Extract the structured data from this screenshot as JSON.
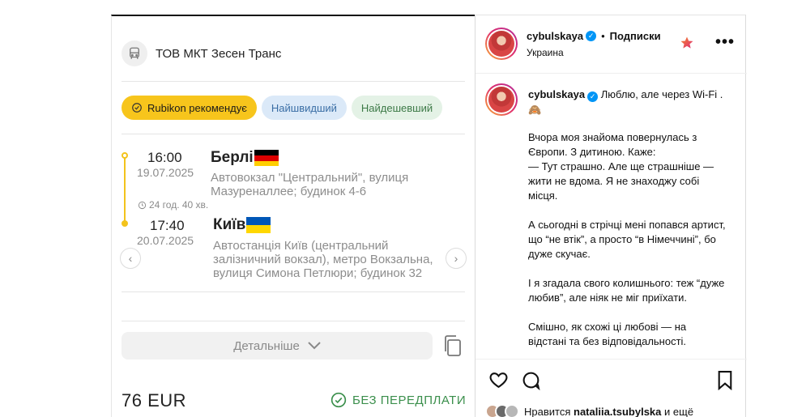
{
  "ticket": {
    "carrier": "ТОВ МКТ Зесен Транс",
    "chips": {
      "recommended": "Rubikon рекомендує",
      "fastest": "Найшвидший",
      "cheapest": "Найдешевший"
    },
    "departure": {
      "time": "16:00",
      "date": "19.07.2025",
      "city": "Берлі",
      "address": "Автовокзал \"Центральний\", вулиця Мазуреналлее; будинок 4-6"
    },
    "duration": "24 год. 40 хв.",
    "arrival": {
      "time": "17:40",
      "date": "20.07.2025",
      "city": "Київ",
      "address": "Автостанція Київ (центральний залізничний вокзал), метро Вокзальна, вулиця Симона Петлюри; будинок 32"
    },
    "details_label": "Детальніше",
    "price": "76 EUR",
    "prepay_label": "БЕЗ ПЕРЕДПЛАТИ",
    "colors": {
      "accent": "#f7c51c",
      "green": "#3b8f4c"
    }
  },
  "post": {
    "header": {
      "username": "cybulskaya",
      "separator": "•",
      "follow": "Подписки",
      "location": "Украина"
    },
    "caption": {
      "username": "cybulskaya",
      "first_line": "Люблю, але через Wi-Fi .🙈",
      "paragraphs": [
        "Вчора моя знайома повернулась з Європи. З дитиною. Каже:\n— Тут страшно. Але ще страшніше — жити не вдома. Я не знаходжу собі місця.",
        "А сьогодні в стрічці мені попався артист, що “не втік”, а просто “в Німеччині”, бо дуже скучає.",
        "І я згадала свого колишнього: теж “дуже любив”, але ніяк не міг приїхати.",
        "Смішно, як схожі ці любові — на відстані та без відповідальності."
      ]
    },
    "likes": {
      "prefix": "Нравится",
      "user": "nataliia.tsubylska",
      "suffix": "и ещё"
    },
    "icons": [
      "heart-icon",
      "comment-icon",
      "bookmark-icon",
      "star-icon",
      "more-icon",
      "verified-icon"
    ]
  }
}
